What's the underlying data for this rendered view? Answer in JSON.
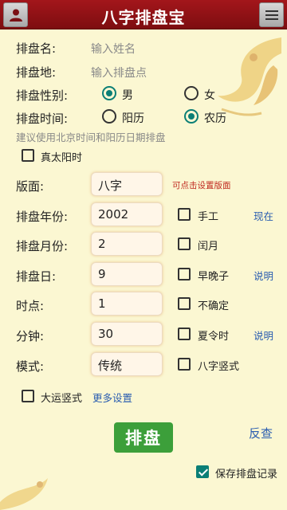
{
  "header": {
    "title": "八字排盘宝",
    "user_icon": "user-icon",
    "menu_icon": "menu-icon"
  },
  "form": {
    "name_label": "排盘名:",
    "name_placeholder": "输入姓名",
    "place_label": "排盘地:",
    "place_placeholder": "输入排盘点",
    "gender_label": "排盘性别:",
    "gender_male": "男",
    "gender_female": "女",
    "gender_selected": "男",
    "calendar_label": "排盘时间:",
    "calendar_solar": "阳历",
    "calendar_lunar": "农历",
    "calendar_selected": "农历",
    "hint": "建议使用北京时间和阳历日期排盘",
    "true_solar": {
      "label": "真太阳时",
      "checked": false
    },
    "layout_label": "版面:",
    "layout_value": "八字",
    "layout_note": "可点击设置版面",
    "year_label": "排盘年份:",
    "year_value": "2002",
    "month_label": "排盘月份:",
    "month_value": "2",
    "day_label": "排盘日:",
    "day_value": "9",
    "hour_label": "时点:",
    "hour_value": "1",
    "minute_label": "分钟:",
    "minute_value": "30",
    "mode_label": "模式:",
    "mode_value": "传统",
    "manual": {
      "label": "手工",
      "checked": false
    },
    "leap_month": {
      "label": "闰月",
      "checked": false
    },
    "early_late_zi": {
      "label": "早晚子",
      "checked": false
    },
    "uncertain": {
      "label": "不确定",
      "checked": false
    },
    "dst": {
      "label": "夏令时",
      "checked": false
    },
    "bazi_vertical": {
      "label": "八字竖式",
      "checked": false
    },
    "dayun_vertical": {
      "label": "大运竖式",
      "checked": false
    },
    "link_now": "现在",
    "link_explain_1": "说明",
    "link_explain_2": "说明",
    "more_settings": "更多设置"
  },
  "actions": {
    "paipan": "排盘",
    "fancha": "反查",
    "save_record": {
      "label": "保存排盘记录",
      "checked": true
    }
  },
  "colors": {
    "header_red": "#8f1116",
    "background": "#fbf7d2",
    "accent_teal": "#0b7f76",
    "button_green": "#3c9f3a",
    "link_blue": "#2a5db0",
    "note_red": "#c0281f"
  }
}
